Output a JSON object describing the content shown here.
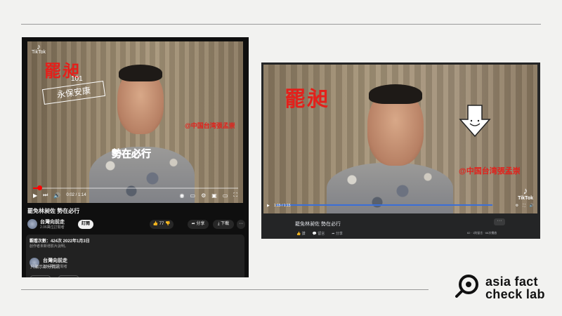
{
  "youtube": {
    "tiktok_label": "TikTok",
    "tiktok_handle": "",
    "overlay_red": "罷昶",
    "overlay_bless_top": "101",
    "overlay_bless": "永保安康",
    "overlay_handle": "@中国台湾張孟崇",
    "overlay_slogan": "勢在必行",
    "time": "0:02 / 1:14",
    "progress": 0.03,
    "title": "罷免林昶佐 勢在必行",
    "channel": "台灣向前走",
    "subs": "2.06萬位訂閱者",
    "subscribe": "訂閱",
    "likes": "77",
    "share": "分享",
    "download": "下載",
    "views_date": "觀看次數：424次  2022年1月3日",
    "no_desc": "創作者未新增影片說明。",
    "about_channel": "台灣向前走",
    "about_subs": "2.06萬位訂閱者",
    "videos_btn": "影片",
    "about_btn": "簡介",
    "footer": "只顯示部分資訊"
  },
  "facebook": {
    "overlay_red": "罷昶",
    "overlay_handle": "@中国台湾張孟崇",
    "tiktok_label": "TikTok",
    "time": "1:15 / 1:15",
    "title": "罷免林昶佐 勢在必行",
    "more": "···",
    "like": "讚",
    "comment": "留言",
    "share": "分享",
    "stats": "62 · 1則留言 · 66次播放"
  },
  "brand": {
    "line1": "asia fact",
    "line2": "check lab"
  }
}
